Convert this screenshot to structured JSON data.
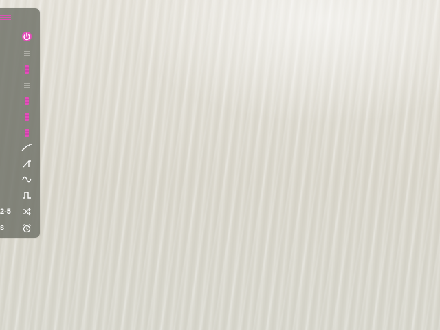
{
  "colors": {
    "accent": "#e24fb9",
    "panel": "#6e7066",
    "icon": "#ffffff"
  },
  "sidebar": {
    "items": [
      {
        "icon": "power-icon",
        "name": "power",
        "active": true
      },
      {
        "icon": "list-icon",
        "name": "list"
      },
      {
        "icon": "palette-icon",
        "name": "color-1"
      },
      {
        "icon": "list-icon",
        "name": "list-2"
      },
      {
        "icon": "palette-icon",
        "name": "color-2"
      },
      {
        "icon": "palette-icon",
        "name": "color-3"
      },
      {
        "icon": "palette-icon",
        "name": "color-4"
      },
      {
        "icon": "ramp-wave-icon",
        "name": "ramp-wave"
      },
      {
        "icon": "sawtooth-wave-icon",
        "name": "sawtooth-wave"
      },
      {
        "icon": "sine-wave-icon",
        "name": "sine-wave"
      },
      {
        "icon": "square-wave-icon",
        "name": "square-wave"
      },
      {
        "icon": "shuffle-icon",
        "name": "shuffle"
      },
      {
        "icon": "alarm-icon",
        "name": "alarm"
      }
    ],
    "side_labels": {
      "shuffle": "2-5",
      "alarm": "s"
    }
  }
}
